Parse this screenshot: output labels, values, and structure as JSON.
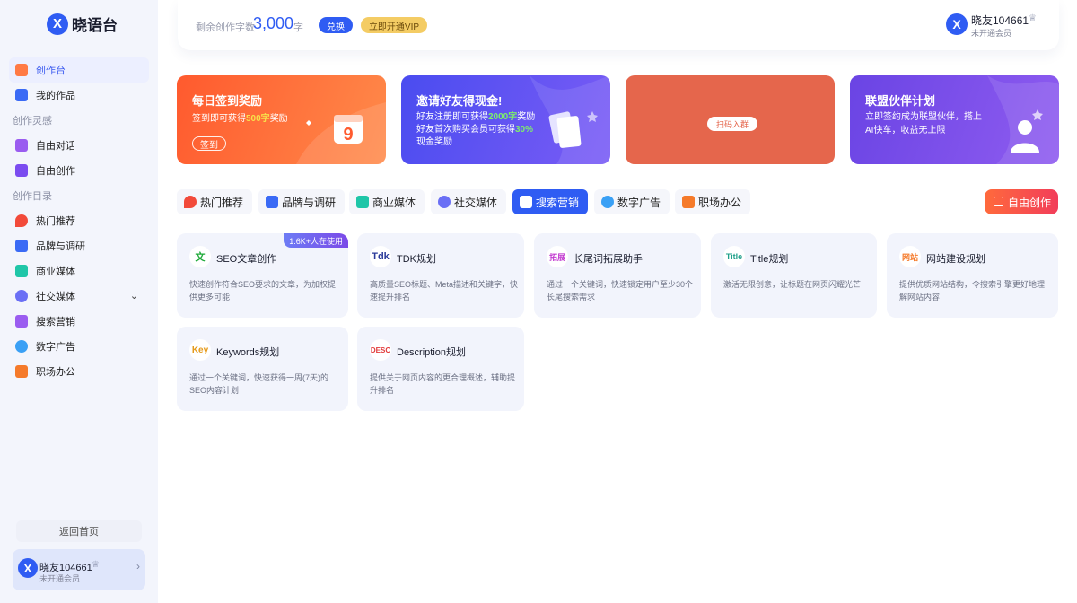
{
  "app": {
    "logo_mark": "X",
    "name": "晓语台"
  },
  "sidebar": {
    "main_items": [
      {
        "label": "创作台",
        "active": true,
        "icon": "create-desk-icon",
        "color": "#ff7a45"
      },
      {
        "label": "我的作品",
        "active": false,
        "icon": "my-works-icon",
        "color": "#3a6af5"
      }
    ],
    "section_inspiration": "创作灵感",
    "inspiration_items": [
      {
        "label": "自由对话",
        "icon": "chat-icon",
        "color": "#9a5cf0"
      },
      {
        "label": "自由创作",
        "icon": "free-create-icon",
        "color": "#7b4cf0"
      }
    ],
    "section_catalog": "创作目录",
    "catalog_items": [
      {
        "label": "热门推荐",
        "icon": "hot-icon",
        "color": "#f24a3a"
      },
      {
        "label": "品牌与调研",
        "icon": "brand-research-icon",
        "color": "#3a6af5"
      },
      {
        "label": "商业媒体",
        "icon": "business-media-icon",
        "color": "#1fc6a8"
      },
      {
        "label": "社交媒体",
        "icon": "social-media-icon",
        "color": "#6a6ff5",
        "expandable": true
      },
      {
        "label": "搜索营销",
        "icon": "search-marketing-icon",
        "color": "#9a5cf0"
      },
      {
        "label": "数字广告",
        "icon": "digital-ad-icon",
        "color": "#3aa0f5"
      },
      {
        "label": "职场办公",
        "icon": "office-icon",
        "color": "#f57a2a"
      }
    ],
    "back_home": "返回首页",
    "user": {
      "avatar": "X",
      "name": "晓友104661",
      "status": "未开通会员"
    }
  },
  "topbar": {
    "quota_label": "剩余创作字数",
    "quota_value": "3,000",
    "quota_unit": "字",
    "exchange_label": "兑换",
    "vip_label": "立即开通VIP",
    "user": {
      "avatar": "X",
      "name": "晓友104661",
      "status": "未开通会员"
    }
  },
  "banners": [
    {
      "title": "每日签到奖励",
      "line1_pre": "签到即可获得",
      "line1_hl": "500字",
      "line1_post": "奖励",
      "button": "签到",
      "color": "#ff6a3a"
    },
    {
      "title": "邀请好友得现金!",
      "line1_pre": "好友注册即可获得",
      "line1_hl": "2000字",
      "line1_post": "奖励",
      "line2_pre": "好友首次购买会员可获得",
      "line2_hl": "30%",
      "line3": "现金奖励",
      "color": "#5a4cf0"
    },
    {
      "button": "扫码入群",
      "color": "#e5664c"
    },
    {
      "title": "联盟伙伴计划",
      "line1": "立即签约成为联盟伙伴，搭上",
      "line2": "AI快车，收益无上限",
      "color": "#7a4ce8"
    }
  ],
  "tabs": [
    {
      "label": "热门推荐",
      "icon": "hot-icon",
      "color": "#f24a3a",
      "active": false
    },
    {
      "label": "品牌与调研",
      "icon": "brand-research-icon",
      "color": "#3a6af5",
      "active": false
    },
    {
      "label": "商业媒体",
      "icon": "business-media-icon",
      "color": "#1fc6a8",
      "active": false
    },
    {
      "label": "社交媒体",
      "icon": "social-media-icon",
      "color": "#6a6ff5",
      "active": false
    },
    {
      "label": "搜索营销",
      "icon": "search-marketing-icon",
      "color": "#ffffff",
      "active": true
    },
    {
      "label": "数字广告",
      "icon": "digital-ad-icon",
      "color": "#3aa0f5",
      "active": false
    },
    {
      "label": "职场办公",
      "icon": "office-icon",
      "color": "#f57a2a",
      "active": false
    }
  ],
  "free_create_button": "自由创作",
  "cards": [
    {
      "title": "SEO文章创作",
      "icon_text": "文",
      "icon_color": "#1faa3a",
      "desc": "快速创作符合SEO要求的文章，为加权提供更多可能",
      "badge": "1.6K+人在使用"
    },
    {
      "title": "TDK规划",
      "icon_text": "Tdk",
      "icon_color": "#2a3a9a",
      "desc": "高质量SEO标题、Meta描述和关键字，快速提升排名"
    },
    {
      "title": "长尾词拓展助手",
      "icon_text": "拓展",
      "icon_color": "#c23ad0",
      "desc": "通过一个关键词，快速锁定用户至少30个长尾搜索需求"
    },
    {
      "title": "Title规划",
      "icon_text": "Title",
      "icon_color": "#1fa08a",
      "desc": "激活无限创意，让标题在网页闪耀光芒"
    },
    {
      "title": "网站建设规划",
      "icon_text": "网站",
      "icon_color": "#f57a2a",
      "desc": "提供优质网站结构，令搜索引擎更好地理解网站内容"
    },
    {
      "title": "Keywords规划",
      "icon_text": "Key",
      "icon_color": "#e59a1a",
      "desc": "通过一个关键词，快速获得一周(7天)的SEO内容计划"
    },
    {
      "title": "Description规划",
      "icon_text": "DESC",
      "icon_color": "#e23a3a",
      "desc": "提供关于网页内容的更合理概述，辅助提升排名"
    }
  ]
}
